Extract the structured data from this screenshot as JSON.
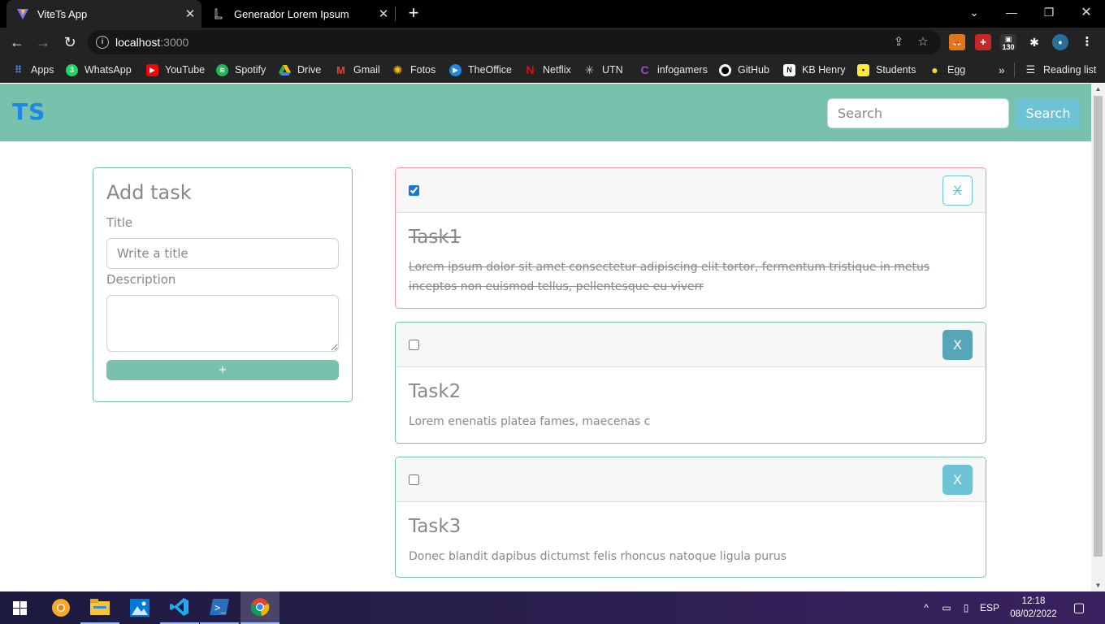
{
  "browser": {
    "tabs": [
      {
        "title": "ViteTs App",
        "active": true
      },
      {
        "title": "Generador Lorem Ipsum",
        "active": false
      }
    ],
    "url": {
      "host": "localhost",
      "port": ":3000"
    },
    "extension_badge": "130",
    "bookmarks": [
      "Apps",
      "WhatsApp",
      "YouTube",
      "Spotify",
      "Drive",
      "Gmail",
      "Fotos",
      "TheOffice",
      "Netflix",
      "UTN",
      "infogamers",
      "GitHub",
      "KB Henry",
      "Students",
      "Egg"
    ],
    "overflow": "»",
    "reading_list": "Reading list"
  },
  "app": {
    "brand": "TS",
    "search": {
      "placeholder": "Search",
      "button": "Search"
    },
    "form": {
      "heading": "Add task",
      "title_label": "Title",
      "title_placeholder": "Write a title",
      "description_label": "Description",
      "add_button": "+"
    },
    "tasks": [
      {
        "title": "Task1",
        "description": "Lorem ipsum dolor sit amet consectetur adipiscing elit tortor, fermentum tristique in metus inceptos non euismod tellus, pellentesque eu viverr",
        "done": true,
        "delete_label": "X"
      },
      {
        "title": "Task2",
        "description": "Lorem enenatis platea fames, maecenas c",
        "done": false,
        "delete_label": "X"
      },
      {
        "title": "Task3",
        "description": "Donec blandit dapibus dictumst felis rhoncus natoque ligula purus",
        "done": false,
        "delete_label": "X"
      }
    ],
    "colors": {
      "primary": "#78c2ad",
      "info": "#6cc3d5",
      "danger_border": "#f3969a",
      "brand": "#1e88e5"
    }
  },
  "taskbar": {
    "language": "ESP",
    "time": "12:18",
    "date": "08/02/2022"
  }
}
